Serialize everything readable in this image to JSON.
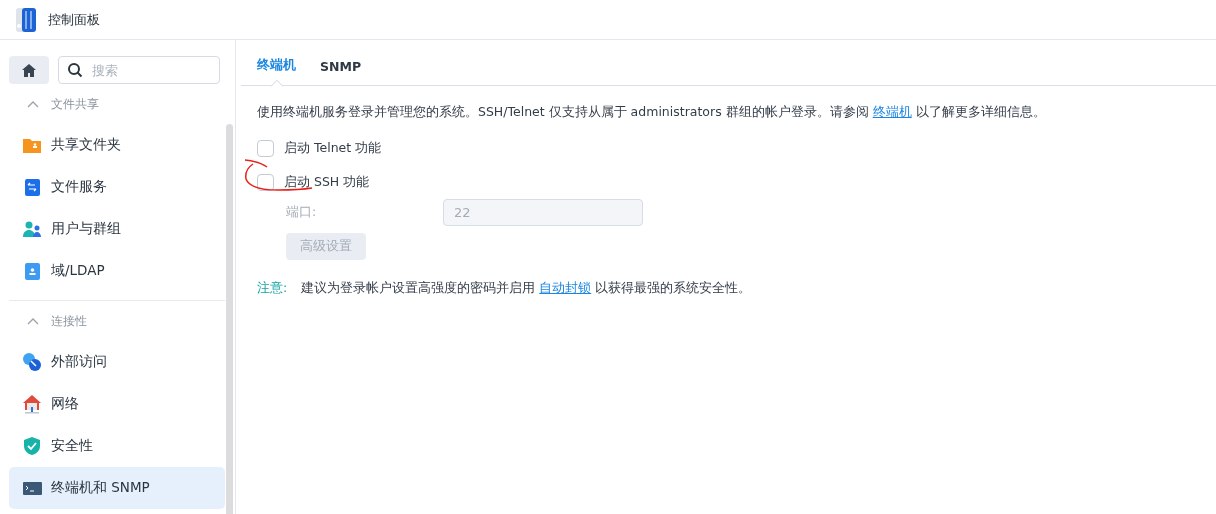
{
  "window": {
    "title": "控制面板"
  },
  "sidebar": {
    "search": {
      "placeholder": "搜索"
    },
    "sections": [
      {
        "title": "文件共享",
        "expanded": true,
        "items": [
          {
            "label": "共享文件夹",
            "kind": "folder",
            "selected": false
          },
          {
            "label": "文件服务",
            "kind": "file-service",
            "selected": false
          },
          {
            "label": "用户与群组",
            "kind": "users",
            "selected": false
          },
          {
            "label": "域/LDAP",
            "kind": "ldap",
            "selected": false
          }
        ]
      },
      {
        "title": "连接性",
        "expanded": true,
        "items": [
          {
            "label": "外部访问",
            "kind": "external",
            "selected": false
          },
          {
            "label": "网络",
            "kind": "network",
            "selected": false
          },
          {
            "label": "安全性",
            "kind": "security",
            "selected": false
          },
          {
            "label": "终端机和 SNMP",
            "kind": "terminal",
            "selected": true
          }
        ]
      }
    ]
  },
  "tabs": [
    {
      "label": "终端机",
      "selected": true
    },
    {
      "label": "SNMP",
      "selected": false
    }
  ],
  "description": {
    "text": "使用终端机服务登录并管理您的系统。SSH/Telnet 仅支持从属于 administrators 群组的帐户登录。请参阅",
    "link": "终端机",
    "after": "以了解更多详细信息。"
  },
  "options": [
    {
      "label": "启动 Telnet 功能",
      "checked": false,
      "annotated": false
    },
    {
      "label": "启动 SSH 功能",
      "checked": false,
      "annotated": true
    }
  ],
  "port": {
    "label": "端口:",
    "value": "22",
    "disabled": true
  },
  "advanced_button": {
    "label": "高级设置",
    "disabled": true
  },
  "note": {
    "prefix": "注意:",
    "text": "建议为登录帐户设置高强度的密码并启用",
    "link": "自动封锁",
    "after": "以获得最强的系统安全性。"
  }
}
